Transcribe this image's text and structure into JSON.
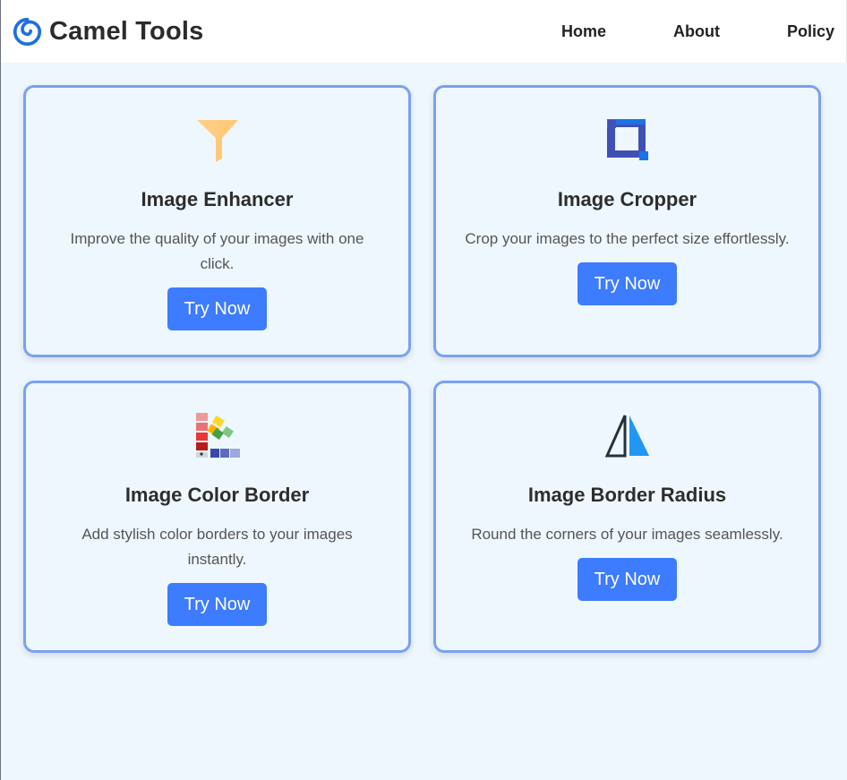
{
  "header": {
    "brand": "Camel Tools",
    "brand_icon": "cyclone-icon",
    "nav": [
      "Home",
      "About",
      "Policy"
    ]
  },
  "cards": [
    {
      "title": "Image Enhancer",
      "description": "Improve the quality of your images with one click.",
      "button": "Try Now",
      "icon": "funnel-icon"
    },
    {
      "title": "Image Cropper",
      "description": "Crop your images to the perfect size effortlessly.",
      "button": "Try Now",
      "icon": "crop-icon"
    },
    {
      "title": "Image Color Border",
      "description": "Add stylish color borders to your images instantly.",
      "button": "Try Now",
      "icon": "color-palette-icon"
    },
    {
      "title": "Image Border Radius",
      "description": "Round the corners of your images seamlessly.",
      "button": "Try Now",
      "icon": "reflect-triangle-icon"
    }
  ],
  "colors": {
    "accent": "#3d7bff",
    "card_border": "#7aa1f0",
    "background": "#eef7fd"
  }
}
